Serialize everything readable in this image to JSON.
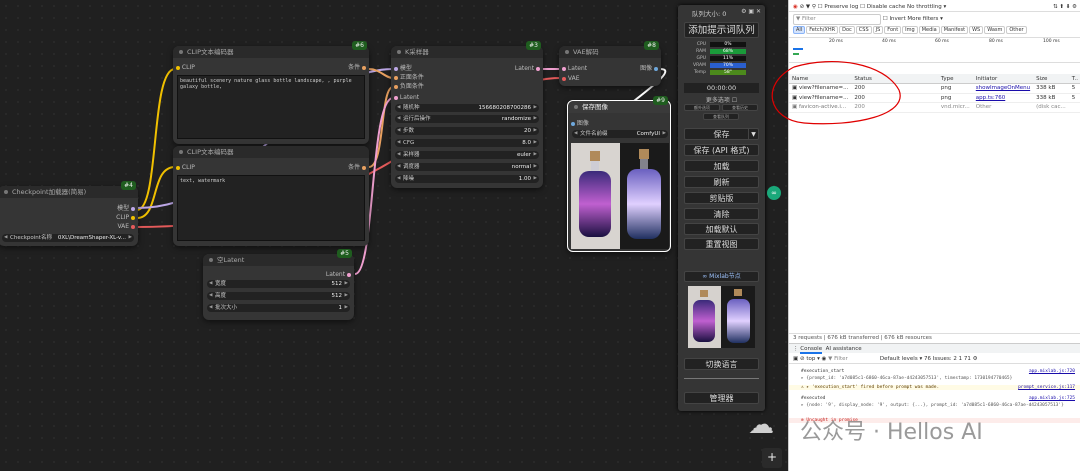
{
  "nodes": {
    "clip_pos": {
      "title": "CLIP文本编码器",
      "id": "#6",
      "in": "CLIP",
      "out": "条件",
      "text": "beautiful scenery nature glass bottle landscape, , purple galaxy bottle,"
    },
    "clip_neg": {
      "title": "CLIP文本编码器",
      "id": "",
      "in": "CLIP",
      "out": "条件",
      "text": "text, watermark"
    },
    "checkpoint": {
      "title": "Checkpoint加载器(简易)",
      "id": "#4",
      "out_model": "模型",
      "out_clip": "CLIP",
      "out_vae": "VAE",
      "widget_label": "Checkpoint名称",
      "widget_value": "0XL\\DreamShaper-XL-v..."
    },
    "ksampler": {
      "title": "K采样器",
      "id": "#3",
      "in_model": "模型",
      "in_pos": "正面条件",
      "in_neg": "负面条件",
      "in_latent": "Latent",
      "out": "Latent",
      "widgets": [
        {
          "label": "随机种",
          "value": "156680208700286"
        },
        {
          "label": "运行后操作",
          "value": "randomize"
        },
        {
          "label": "步数",
          "value": "20"
        },
        {
          "label": "CFG",
          "value": "8.0"
        },
        {
          "label": "采样器",
          "value": "euler"
        },
        {
          "label": "调度器",
          "value": "normal"
        },
        {
          "label": "降噪",
          "value": "1.00"
        }
      ]
    },
    "vae": {
      "title": "VAE解码",
      "id": "#8",
      "in_latent": "Latent",
      "in_vae": "VAE",
      "out": "图像"
    },
    "save": {
      "title": "保存图像",
      "id": "#9",
      "in": "图像",
      "prefix_label": "文件名前缀",
      "prefix_value": "ComfyUI"
    },
    "latent": {
      "title": "空Latent",
      "id": "#5",
      "out": "Latent",
      "widgets": [
        {
          "label": "宽度",
          "value": "512"
        },
        {
          "label": "高度",
          "value": "512"
        },
        {
          "label": "批次大小",
          "value": "1"
        }
      ]
    }
  },
  "panel": {
    "title": "队列大小: 0",
    "queue_btn": "添加提示词队列",
    "stats": [
      {
        "label": "CPU",
        "value": "0%"
      },
      {
        "label": "RAM",
        "value": "68%"
      },
      {
        "label": "GPU",
        "value": "11%"
      },
      {
        "label": "VRAM",
        "value": "70%"
      },
      {
        "label": "Temp",
        "value": "58°"
      }
    ],
    "time": "00:00:00",
    "more": "更多选项",
    "small": [
      "额外选项",
      "查看历史",
      "查看队列"
    ],
    "buttons": [
      "保存",
      "保存 (API 格式)",
      "加载",
      "刷新",
      "剪贴版",
      "清除",
      "加载默认",
      "重置视图"
    ],
    "mixlab": "∞ Mixlab节点",
    "lang": "切换语言",
    "manager": "管理器",
    "add": "+"
  },
  "devtools": {
    "preserve": "Preserve log",
    "disable_cache": "Disable cache",
    "throttle": "No throttling",
    "filter": "Filter",
    "invert": "Invert",
    "more_filters": "More filters ▾",
    "types": [
      "All",
      "Fetch/XHR",
      "Doc",
      "CSS",
      "JS",
      "Font",
      "Img",
      "Media",
      "Manifest",
      "WS",
      "Wasm",
      "Other"
    ],
    "ticks": [
      "20 ms",
      "40 ms",
      "60 ms",
      "80 ms",
      "100 ms"
    ],
    "cols": [
      "Name",
      "Status",
      "Type",
      "Initiator",
      "Size",
      "T.."
    ],
    "rows": [
      {
        "name": "view?filename=...",
        "status": "200",
        "type": "png",
        "init": "showImageOnMenu",
        "size": "338 kB",
        "t": "5"
      },
      {
        "name": "view?filename=...",
        "status": "200",
        "type": "png",
        "init": "app.ts:760",
        "size": "338 kB",
        "t": "5"
      },
      {
        "name": "favicon-active.i...",
        "status": "200",
        "type": "vnd.micr...",
        "init": "Other",
        "size": "(disk cac...",
        "t": ""
      }
    ],
    "summary": "3 requests  |  676 kB transferred  |  676 kB resources",
    "console_tab": "Console",
    "ai_tab": "AI assistance",
    "top": "top ▾",
    "filter2": "Filter",
    "levels": "Default levels ▾",
    "issues": "76 Issues: 2  1  71",
    "log": [
      {
        "text": "#execution_start",
        "src": "app.mixlab.js:720"
      },
      {
        "text": "▸ {prompt_id: 'a7d085c1-6860-46ca-87ae-d4243057513', timestamp: 1730194770465}",
        "src": ""
      },
      {
        "text": "⚠ ▸ 'execution_start' fired before prompt was made.",
        "src": "prompt_service.js:117"
      },
      {
        "text": "#executed",
        "src": "app.mixlab.js:725"
      },
      {
        "text": "▸ {node: '9', display_node: '9', output: {...}, prompt_id: 'a7d085c1-6860-46ca-87ae-d4243057513'}",
        "src": ""
      },
      {
        "text": "⊗ Uncaught in promise",
        "src": ""
      }
    ],
    "watermark": "公众号 · Hellos AI"
  }
}
